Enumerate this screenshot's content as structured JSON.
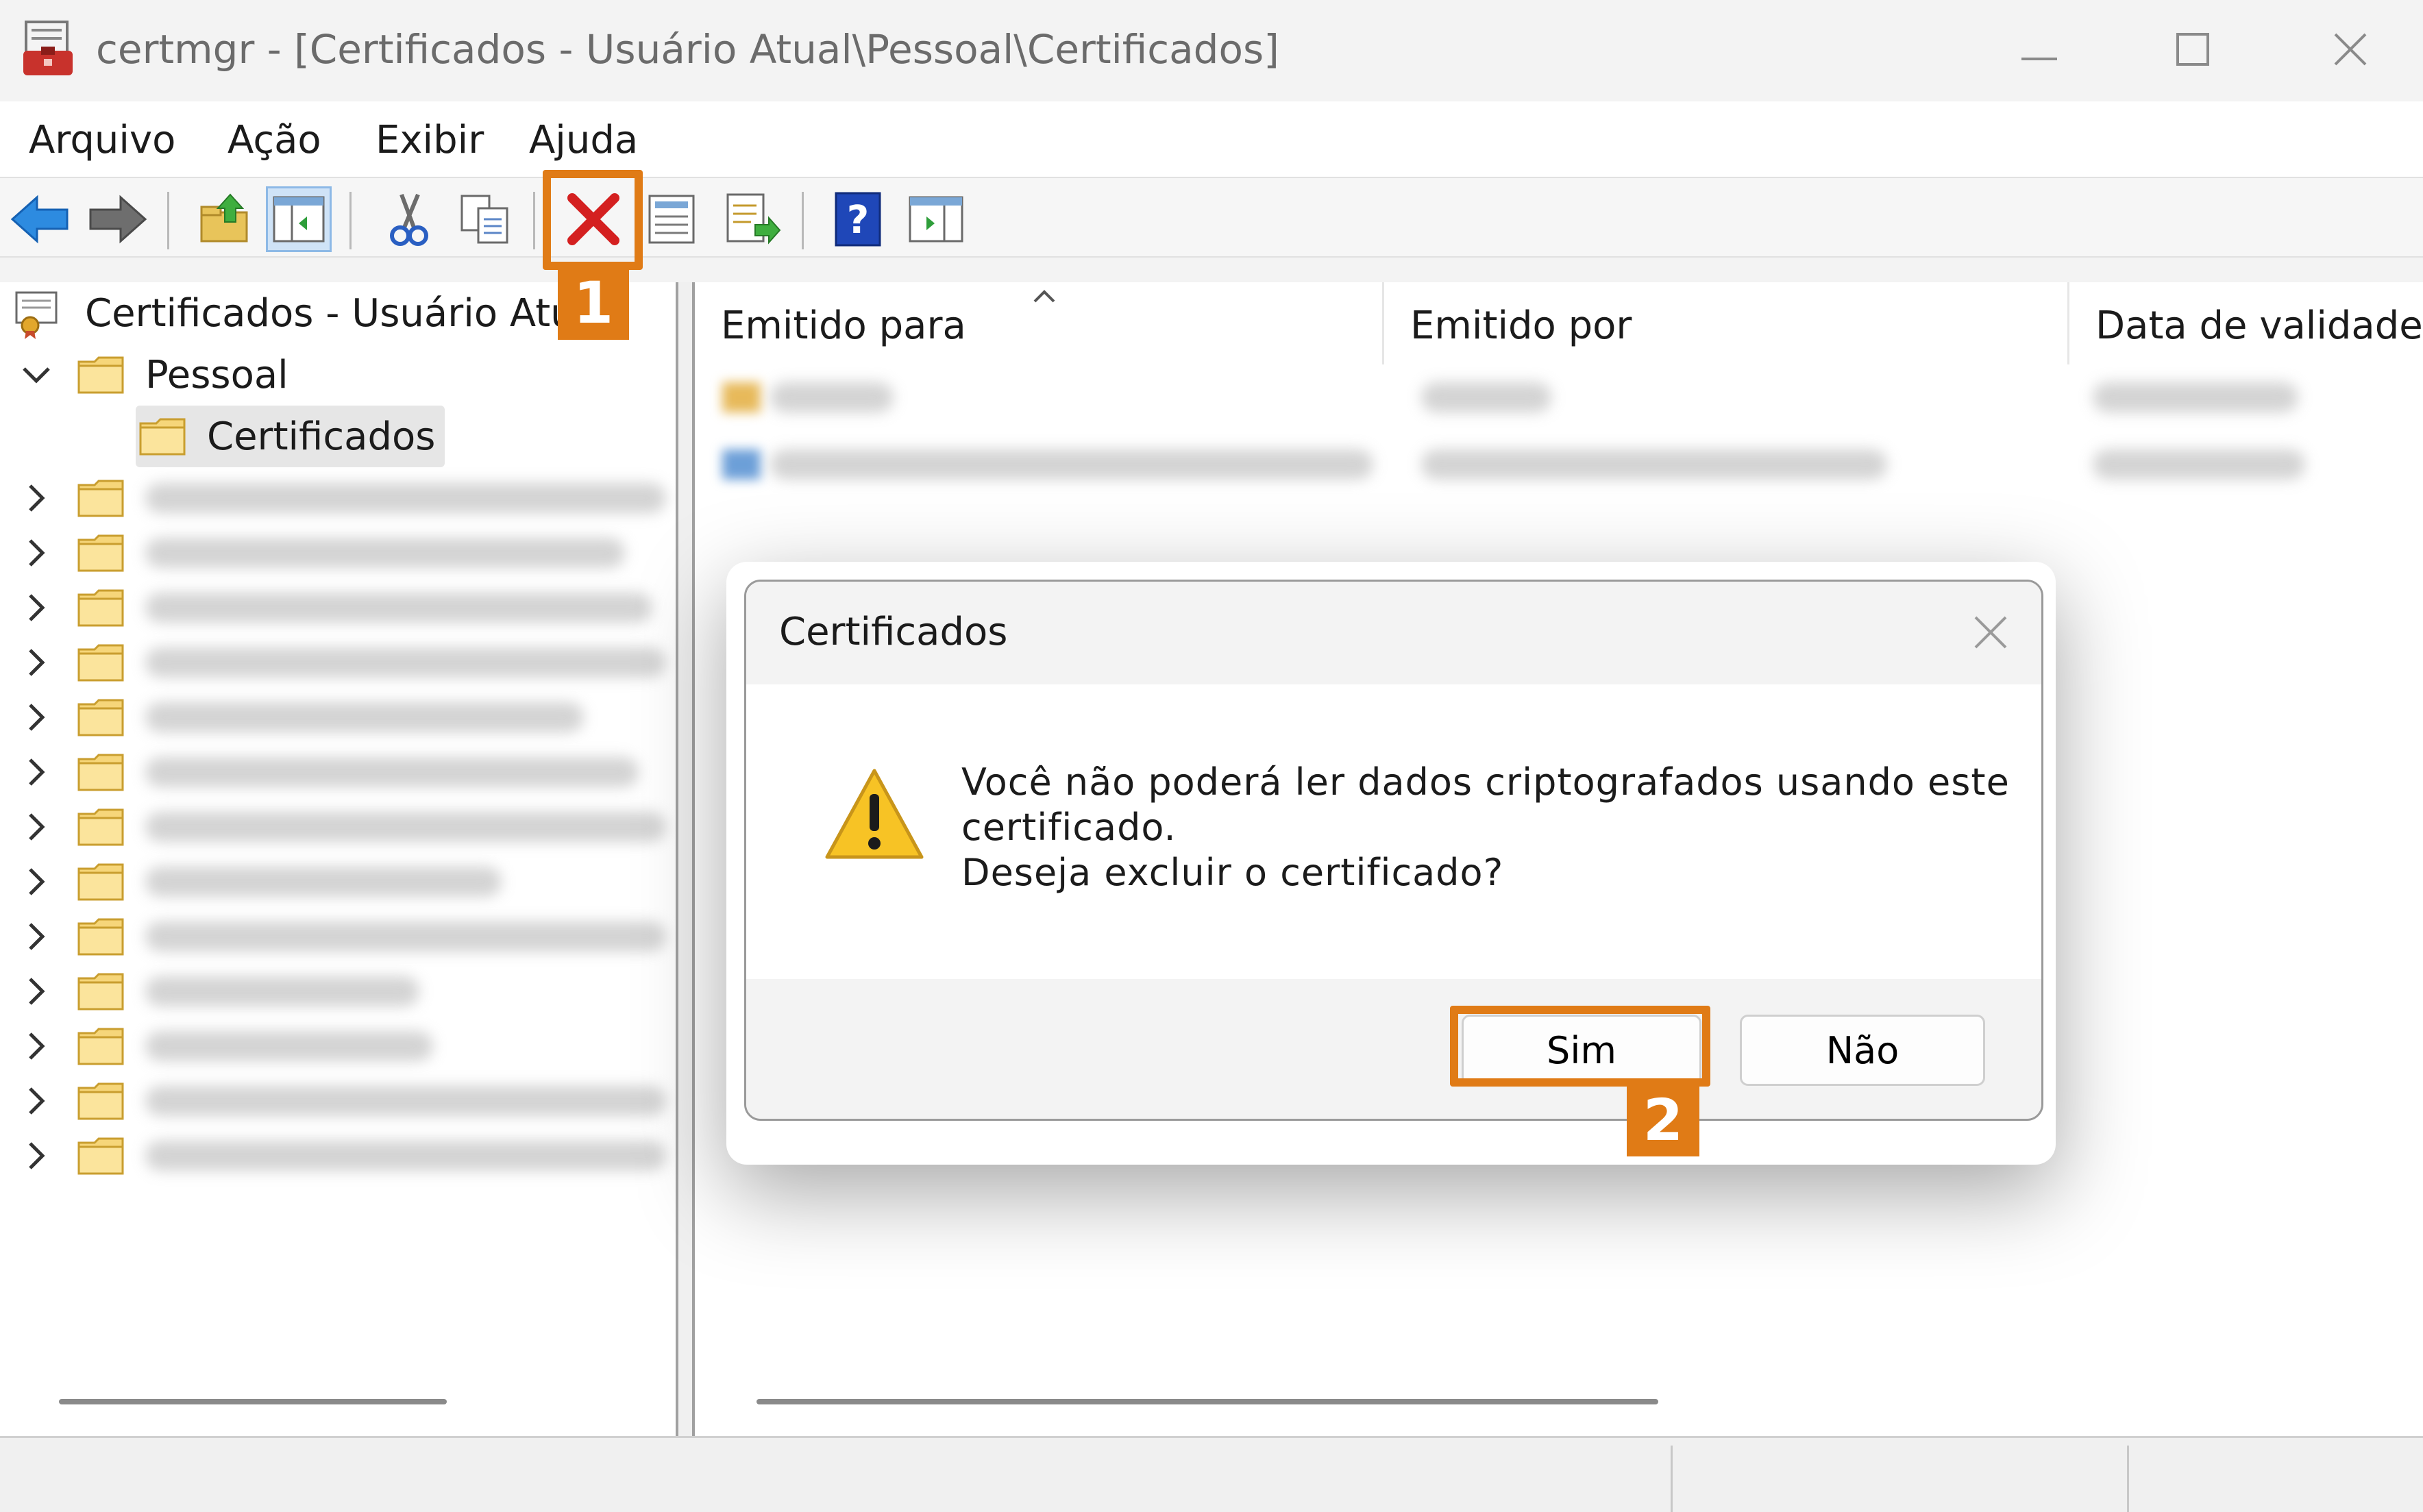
{
  "window": {
    "title": "certmgr - [Certificados - Usuário Atual\\Pessoal\\Certificados]"
  },
  "menu": [
    {
      "label": "Arquivo"
    },
    {
      "label": "Ação"
    },
    {
      "label": "Exibir"
    },
    {
      "label": "Ajuda"
    }
  ],
  "toolbar": {
    "buttons": [
      {
        "icon": "back-arrow-icon"
      },
      {
        "icon": "forward-arrow-icon"
      },
      {
        "icon": "up-folder-icon"
      },
      {
        "icon": "show-hide-tree-icon"
      },
      {
        "icon": "cut-icon"
      },
      {
        "icon": "copy-icon"
      },
      {
        "icon": "delete-icon"
      },
      {
        "icon": "properties-icon"
      },
      {
        "icon": "export-list-icon"
      },
      {
        "icon": "help-icon"
      },
      {
        "icon": "action-pane-icon"
      }
    ]
  },
  "tree": {
    "root": "Certificados - Usuário Atual",
    "pessoal": "Pessoal",
    "certificados": "Certificados",
    "blurred_item_count_visible": 13
  },
  "list": {
    "columns": [
      "Emitido para",
      "Emitido por",
      "Data de validade"
    ]
  },
  "dialog": {
    "title": "Certificados",
    "message_line1": "Você não poderá ler dados criptografados usando este",
    "message_line2": "certificado.",
    "message_line3": "Deseja excluir o certificado?",
    "yes_label": "Sim",
    "no_label": "Não"
  },
  "callouts": {
    "step1": "1",
    "step2": "2"
  },
  "colors": {
    "callout": "#e07b16",
    "delete_icon": "#d42020",
    "help_icon": "#1f47b8"
  }
}
